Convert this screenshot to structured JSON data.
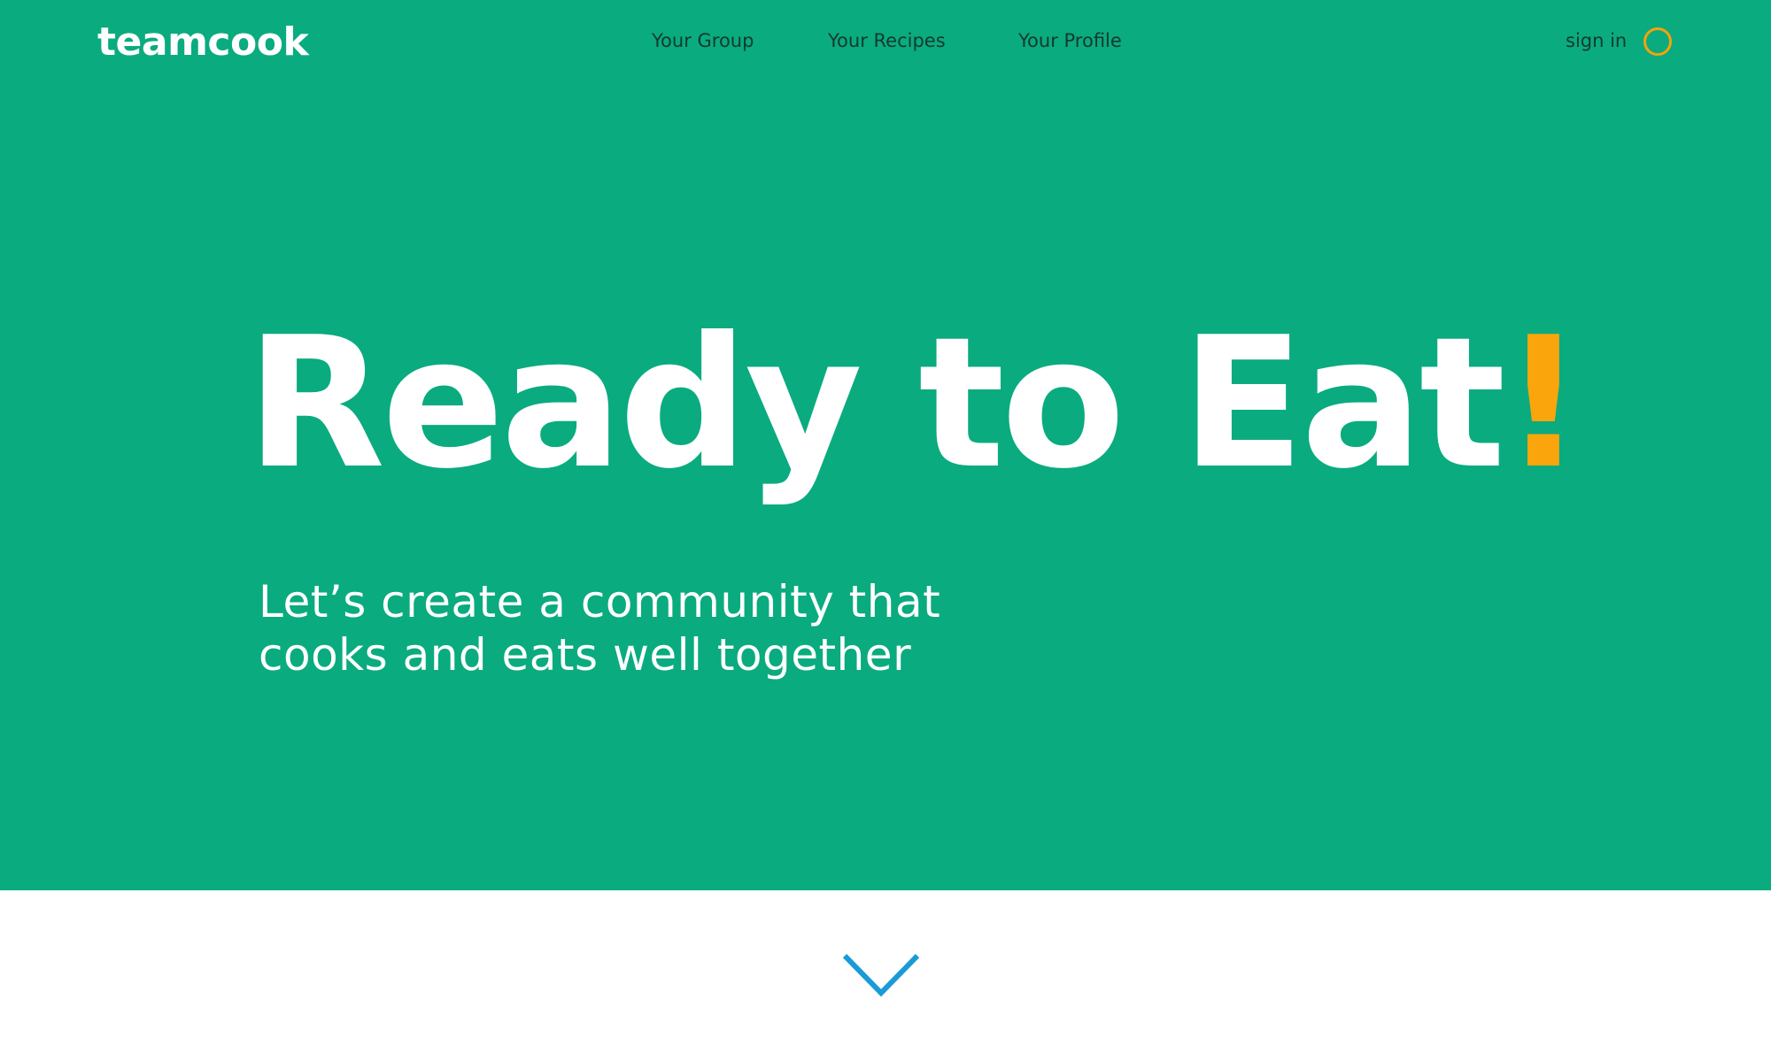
{
  "brand": {
    "name": "teamcook"
  },
  "nav": {
    "items": [
      {
        "label": "Your Group"
      },
      {
        "label": "Your Recipes"
      },
      {
        "label": "Your Profile"
      }
    ]
  },
  "auth": {
    "sign_in_label": "sign in",
    "avatar_icon": "user-circle-icon"
  },
  "hero": {
    "headline": "Ready to Eat",
    "headline_accent": "!",
    "tagline_lines": [
      "Let’s create a community that",
      "cooks and eats well together"
    ]
  },
  "scroll": {
    "icon": "chevron-down-icon"
  },
  "colors": {
    "hero_background": "#0aab7f",
    "accent": "#fba50c",
    "avatar_ring": "#f5a20b",
    "chevron": "#1a9bd7",
    "page_background": "#ffffff",
    "nav_text": "#123a2f"
  }
}
